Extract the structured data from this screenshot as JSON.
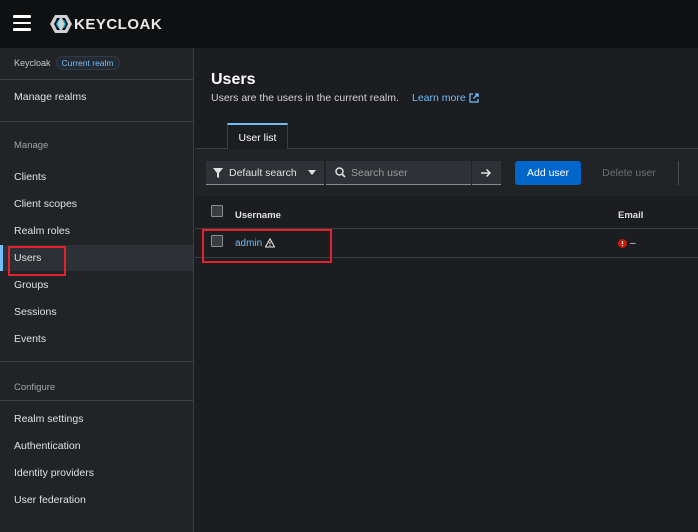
{
  "header": {
    "brand": "KEYCLOAK"
  },
  "sidebar": {
    "realm": {
      "name": "Keycloak",
      "badge": "Current realm"
    },
    "manage_realms": "Manage realms",
    "sections": [
      {
        "title": "Manage",
        "items": [
          "Clients",
          "Client scopes",
          "Realm roles",
          "Users",
          "Groups",
          "Sessions",
          "Events"
        ]
      },
      {
        "title": "Configure",
        "items": [
          "Realm settings",
          "Authentication",
          "Identity providers",
          "User federation"
        ]
      }
    ],
    "active_item": "Users"
  },
  "main": {
    "title": "Users",
    "description": "Users are the users in the current realm.",
    "learn_more": "Learn more",
    "tabs": [
      {
        "label": "User list",
        "selected": true
      }
    ],
    "toolbar": {
      "filter_label": "Default search",
      "search_placeholder": "Search user",
      "add_user": "Add user",
      "delete_user": "Delete user"
    },
    "table": {
      "columns": [
        "Username",
        "Email"
      ],
      "rows": [
        {
          "username": "admin",
          "email": "–",
          "username_warning": true,
          "email_error": true
        }
      ]
    }
  },
  "colors": {
    "accent": "#73bcf7",
    "primary_button": "#0066cc",
    "error": "#c9190b",
    "highlight_box": "#e2222e"
  }
}
